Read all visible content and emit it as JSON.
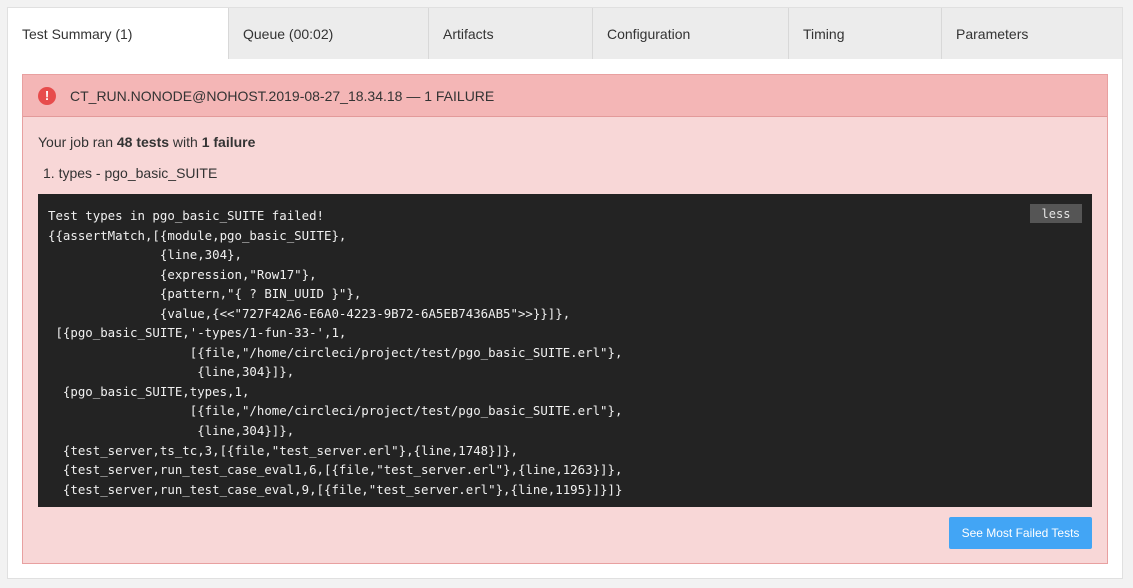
{
  "tabs": [
    {
      "label": "Test Summary (1)",
      "active": true
    },
    {
      "label": "Queue (00:02)",
      "active": false
    },
    {
      "label": "Artifacts",
      "active": false
    },
    {
      "label": "Configuration",
      "active": false
    },
    {
      "label": "Timing",
      "active": false
    },
    {
      "label": "Parameters",
      "active": false
    }
  ],
  "failure_panel": {
    "title": "CT_RUN.NONODE@NOHOST.2019-08-27_18.34.18 — 1 FAILURE",
    "icon": "exclamation-circle-icon",
    "summary": {
      "prefix": "Your job ran ",
      "tests": "48 tests",
      "middle": " with ",
      "failures": "1 failure"
    },
    "failures": [
      {
        "number": "1.",
        "name": "types - pgo_basic_SUITE"
      }
    ],
    "output": "Test types in pgo_basic_SUITE failed!\n{{assertMatch,[{module,pgo_basic_SUITE},\n               {line,304},\n               {expression,\"Row17\"},\n               {pattern,\"{ ? BIN_UUID }\"},\n               {value,{<<\"727F42A6-E6A0-4223-9B72-6A5EB7436AB5\">>}}]},\n [{pgo_basic_SUITE,'-types/1-fun-33-',1,\n                   [{file,\"/home/circleci/project/test/pgo_basic_SUITE.erl\"},\n                    {line,304}]},\n  {pgo_basic_SUITE,types,1,\n                   [{file,\"/home/circleci/project/test/pgo_basic_SUITE.erl\"},\n                    {line,304}]},\n  {test_server,ts_tc,3,[{file,\"test_server.erl\"},{line,1748}]},\n  {test_server,run_test_case_eval1,6,[{file,\"test_server.erl\"},{line,1263}]},\n  {test_server,run_test_case_eval,9,[{file,\"test_server.erl\"},{line,1195}]}]}",
    "less_label": "less",
    "see_most_failed_label": "See Most Failed Tests"
  },
  "colors": {
    "panel_bg": "#f8d7d7",
    "panel_header_bg": "#f4b6b6",
    "error_icon": "#e74c4c",
    "code_bg": "#232323",
    "button_blue": "#42a5f5"
  }
}
